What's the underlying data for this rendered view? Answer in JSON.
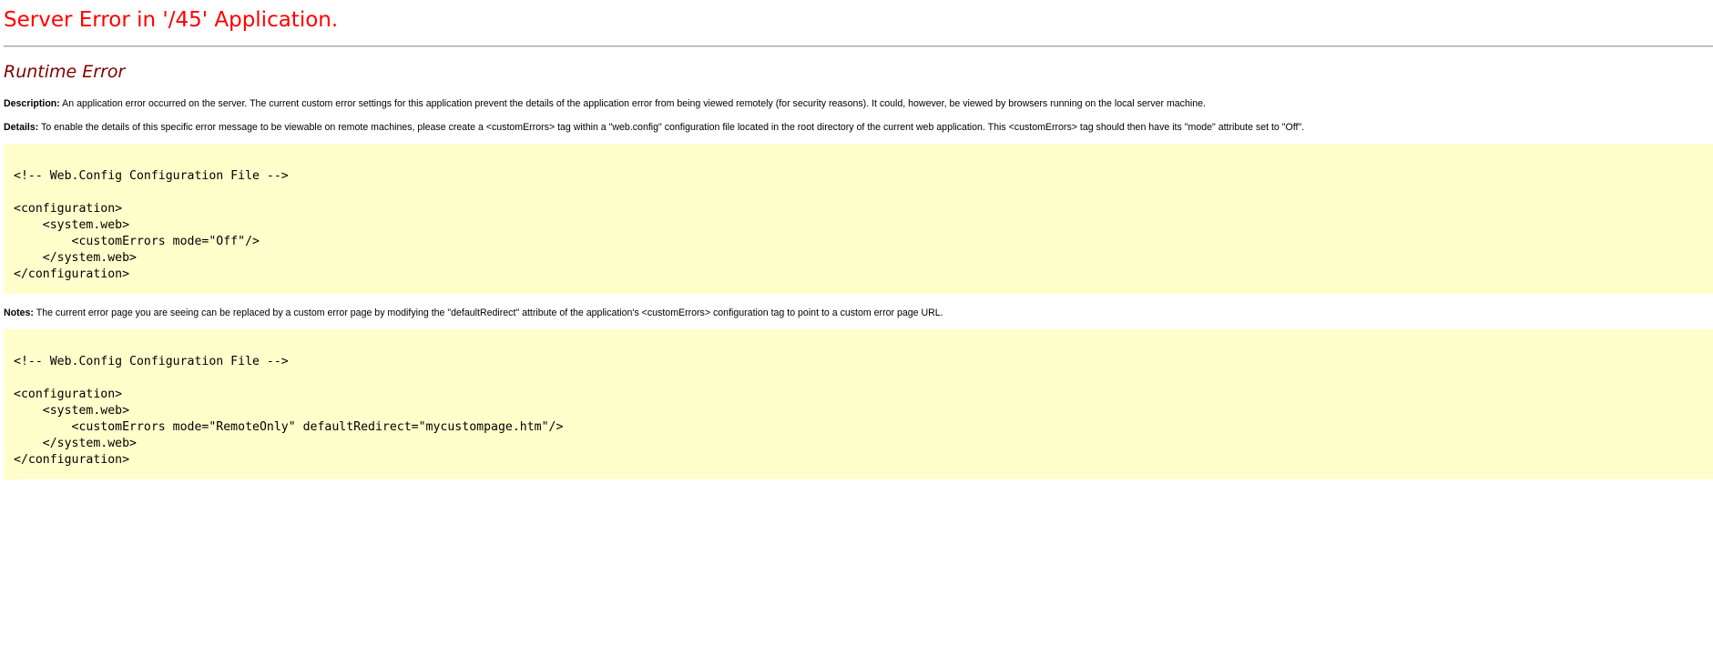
{
  "page": {
    "title": "Server Error in '/45' Application.",
    "subtitle": "Runtime Error"
  },
  "description": {
    "label": "Description:",
    "text": " An application error occurred on the server. The current custom error settings for this application prevent the details of the application error from being viewed remotely (for security reasons). It could, however, be viewed by browsers running on the local server machine."
  },
  "details": {
    "label": "Details:",
    "text": " To enable the details of this specific error message to be viewable on remote machines, please create a <customErrors> tag within a \"web.config\" configuration file located in the root directory of the current web application. This <customErrors> tag should then have its \"mode\" attribute set to \"Off\"."
  },
  "code_block_1": {
    "lines": [
      "<!-- Web.Config Configuration File -->",
      "",
      "<configuration>",
      "    <system.web>",
      "        <customErrors mode=\"Off\"/>",
      "    </system.web>",
      "</configuration>"
    ]
  },
  "notes": {
    "label": "Notes:",
    "text": " The current error page you are seeing can be replaced by a custom error page by modifying the \"defaultRedirect\" attribute of the application's <customErrors> configuration tag to point to a custom error page URL."
  },
  "code_block_2": {
    "lines": [
      "<!-- Web.Config Configuration File -->",
      "",
      "<configuration>",
      "    <system.web>",
      "        <customErrors mode=\"RemoteOnly\" defaultRedirect=\"mycustompage.htm\"/>",
      "    </system.web>",
      "</configuration>"
    ]
  },
  "colors": {
    "title": "#ff0000",
    "subtitle": "#800000",
    "code_background": "#ffffcc"
  }
}
